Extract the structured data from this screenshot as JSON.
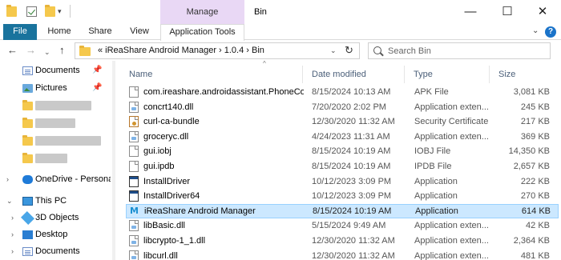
{
  "window": {
    "title": "Bin",
    "manage_label": "Manage",
    "minimize": "—",
    "maximize": "☐",
    "close": "✕",
    "quick_access_dropdown": "▾"
  },
  "ribbon": {
    "tabs": [
      "File",
      "Home",
      "Share",
      "View",
      "Application Tools"
    ],
    "collapse_chevron": "⌄",
    "help": "?"
  },
  "address": {
    "back": "←",
    "forward": "→",
    "recent": "⌄",
    "up": "↑",
    "path_text": "«  iReaShare Android Manager  ›  1.0.4  ›  Bin",
    "dropdown": "⌄",
    "refresh": "↻"
  },
  "search": {
    "placeholder": "Search Bin"
  },
  "navpane": {
    "documents": "Documents",
    "pictures": "Pictures",
    "onedrive": "OneDrive - Persona",
    "this_pc": "This PC",
    "objects_3d": "3D Objects",
    "desktop": "Desktop",
    "documents_pc": "Documents",
    "pin": "📌",
    "expand": "›",
    "expanded": "⌄"
  },
  "columns": {
    "name": "Name",
    "date": "Date modified",
    "type": "Type",
    "size": "Size",
    "sort_indicator": "^"
  },
  "files": [
    {
      "name": "com.ireashare.androidassistant.PhoneCo...",
      "date": "8/15/2024 10:13 AM",
      "type": "APK File",
      "size": "3,081 KB",
      "icon": "file-icon"
    },
    {
      "name": "concrt140.dll",
      "date": "7/20/2020 2:02 PM",
      "type": "Application exten...",
      "size": "245 KB",
      "icon": "dll-icon"
    },
    {
      "name": "curl-ca-bundle",
      "date": "12/30/2020 11:32 AM",
      "type": "Security Certificate",
      "size": "217 KB",
      "icon": "certificate-icon"
    },
    {
      "name": "groceryc.dll",
      "date": "4/24/2023 11:31 AM",
      "type": "Application exten...",
      "size": "369 KB",
      "icon": "dll-icon"
    },
    {
      "name": "gui.iobj",
      "date": "8/15/2024 10:19 AM",
      "type": "IOBJ File",
      "size": "14,350 KB",
      "icon": "file-icon"
    },
    {
      "name": "gui.ipdb",
      "date": "8/15/2024 10:19 AM",
      "type": "IPDB File",
      "size": "2,657 KB",
      "icon": "file-icon"
    },
    {
      "name": "InstallDriver",
      "date": "10/12/2023 3:09 PM",
      "type": "Application",
      "size": "222 KB",
      "icon": "exe-icon"
    },
    {
      "name": "InstallDriver64",
      "date": "10/12/2023 3:09 PM",
      "type": "Application",
      "size": "270 KB",
      "icon": "exe-icon"
    },
    {
      "name": "iReaShare Android Manager",
      "date": "8/15/2024 10:19 AM",
      "type": "Application",
      "size": "614 KB",
      "icon": "ireashare-app-icon",
      "selected": true
    },
    {
      "name": "libBasic.dll",
      "date": "5/15/2024 9:49 AM",
      "type": "Application exten...",
      "size": "42 KB",
      "icon": "dll-icon"
    },
    {
      "name": "libcrypto-1_1.dll",
      "date": "12/30/2020 11:32 AM",
      "type": "Application exten...",
      "size": "2,364 KB",
      "icon": "dll-icon"
    },
    {
      "name": "libcurl.dll",
      "date": "12/30/2020 11:32 AM",
      "type": "Application exten...",
      "size": "481 KB",
      "icon": "dll-icon"
    }
  ],
  "colors": {
    "file_tab": "#19739d",
    "manage_tab": "#e9d8f5",
    "selection": "#cce8ff",
    "header_text": "#4c607a"
  }
}
